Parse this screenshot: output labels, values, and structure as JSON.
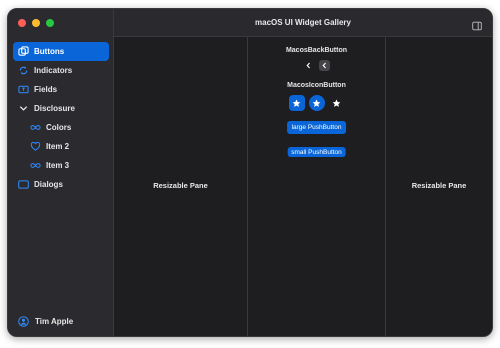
{
  "window": {
    "title": "macOS UI Widget Gallery"
  },
  "sidebar": {
    "items": [
      {
        "label": "Buttons",
        "icon": "square-on-square-icon",
        "selected": true
      },
      {
        "label": "Indicators",
        "icon": "arrows-circle-icon"
      },
      {
        "label": "Fields",
        "icon": "textfield-icon"
      },
      {
        "label": "Disclosure",
        "icon": "chevron-down-icon"
      },
      {
        "label": "Colors",
        "icon": "infinity-icon"
      },
      {
        "label": "Item 2",
        "icon": "heart-icon"
      },
      {
        "label": "Item 3",
        "icon": "infinity-icon"
      },
      {
        "label": "Dialogs",
        "icon": "rectangle-icon"
      }
    ],
    "user": {
      "label": "Tim Apple",
      "icon": "person-circle-icon"
    }
  },
  "panes": {
    "left_label": "Resizable Pane",
    "right_label": "Resizable Pane"
  },
  "buttons_demo": {
    "back_button_title": "MacosBackButton",
    "icon_button_title": "MacosIconButton",
    "large_push_label": "large PushButton",
    "small_push_label": "small PushButton"
  },
  "colors": {
    "accent": "#0a66d8",
    "sidebar_bg": "#2b2a2f",
    "content_bg": "#1e1e20"
  }
}
